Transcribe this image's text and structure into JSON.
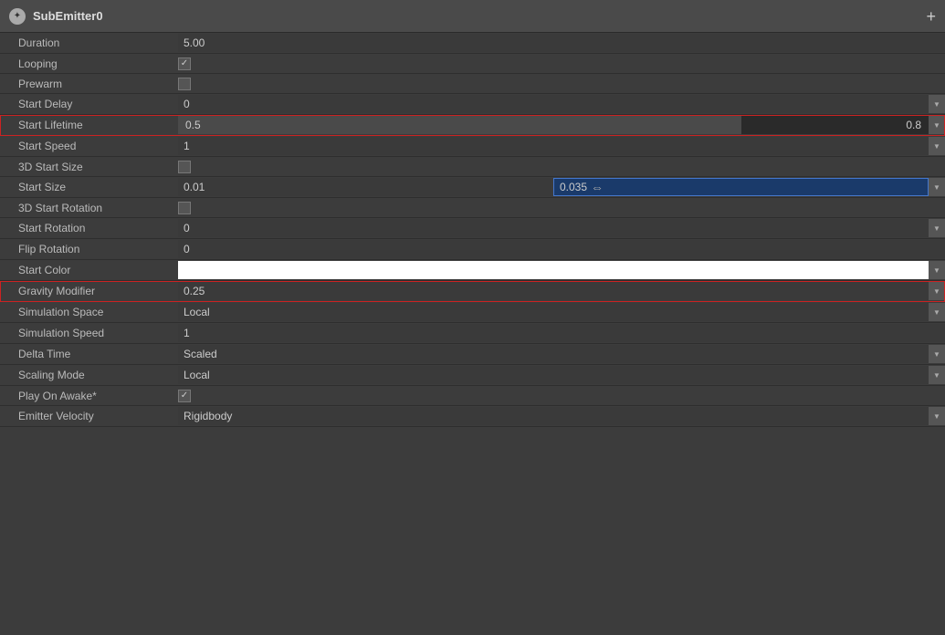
{
  "panel": {
    "title": "SubEmitter0",
    "add_label": "+"
  },
  "rows": [
    {
      "id": "duration",
      "label": "Duration",
      "value": "5.00",
      "type": "simple",
      "has_dropdown": false,
      "highlighted": false
    },
    {
      "id": "looping",
      "label": "Looping",
      "value": "✓",
      "type": "checkbox_checked",
      "has_dropdown": false,
      "highlighted": false
    },
    {
      "id": "prewarm",
      "label": "Prewarm",
      "value": "",
      "type": "checkbox_empty",
      "has_dropdown": false,
      "highlighted": false
    },
    {
      "id": "start_delay",
      "label": "Start Delay",
      "value": "0",
      "type": "simple",
      "has_dropdown": true,
      "highlighted": false
    },
    {
      "id": "start_lifetime",
      "label": "Start Lifetime",
      "value1": "0.5",
      "value2": "0.8",
      "type": "range",
      "has_dropdown": true,
      "highlighted": true
    },
    {
      "id": "start_speed",
      "label": "Start Speed",
      "value": "1",
      "type": "simple",
      "has_dropdown": true,
      "highlighted": false
    },
    {
      "id": "3d_start_size",
      "label": "3D Start Size",
      "value": "",
      "type": "checkbox_empty",
      "has_dropdown": false,
      "highlighted": false
    },
    {
      "id": "start_size",
      "label": "Start Size",
      "value1": "0.01",
      "value2": "0.035",
      "type": "dual",
      "has_dropdown": true,
      "highlighted": false
    },
    {
      "id": "3d_start_rotation",
      "label": "3D Start Rotation",
      "value": "",
      "type": "checkbox_empty",
      "has_dropdown": false,
      "highlighted": false
    },
    {
      "id": "start_rotation",
      "label": "Start Rotation",
      "value": "0",
      "type": "simple",
      "has_dropdown": true,
      "highlighted": false
    },
    {
      "id": "flip_rotation",
      "label": "Flip Rotation",
      "value": "0",
      "type": "simple",
      "has_dropdown": false,
      "highlighted": false
    },
    {
      "id": "start_color",
      "label": "Start Color",
      "value": "",
      "type": "color",
      "has_dropdown": true,
      "highlighted": false
    },
    {
      "id": "gravity_modifier",
      "label": "Gravity Modifier",
      "value": "0.25",
      "type": "simple",
      "has_dropdown": true,
      "highlighted": true
    },
    {
      "id": "simulation_space",
      "label": "Simulation Space",
      "value": "Local",
      "type": "simple",
      "has_dropdown": true,
      "highlighted": false
    },
    {
      "id": "simulation_speed",
      "label": "Simulation Speed",
      "value": "1",
      "type": "simple",
      "has_dropdown": false,
      "highlighted": false
    },
    {
      "id": "delta_time",
      "label": "Delta Time",
      "value": "Scaled",
      "type": "simple",
      "has_dropdown": true,
      "highlighted": false
    },
    {
      "id": "scaling_mode",
      "label": "Scaling Mode",
      "value": "Local",
      "type": "simple",
      "has_dropdown": true,
      "highlighted": false
    },
    {
      "id": "play_on_awake",
      "label": "Play On Awake*",
      "value": "✓",
      "type": "checkbox_checked",
      "has_dropdown": false,
      "highlighted": false
    },
    {
      "id": "emitter_velocity",
      "label": "Emitter Velocity",
      "value": "Rigidbody",
      "type": "simple",
      "has_dropdown": true,
      "highlighted": false
    }
  ]
}
